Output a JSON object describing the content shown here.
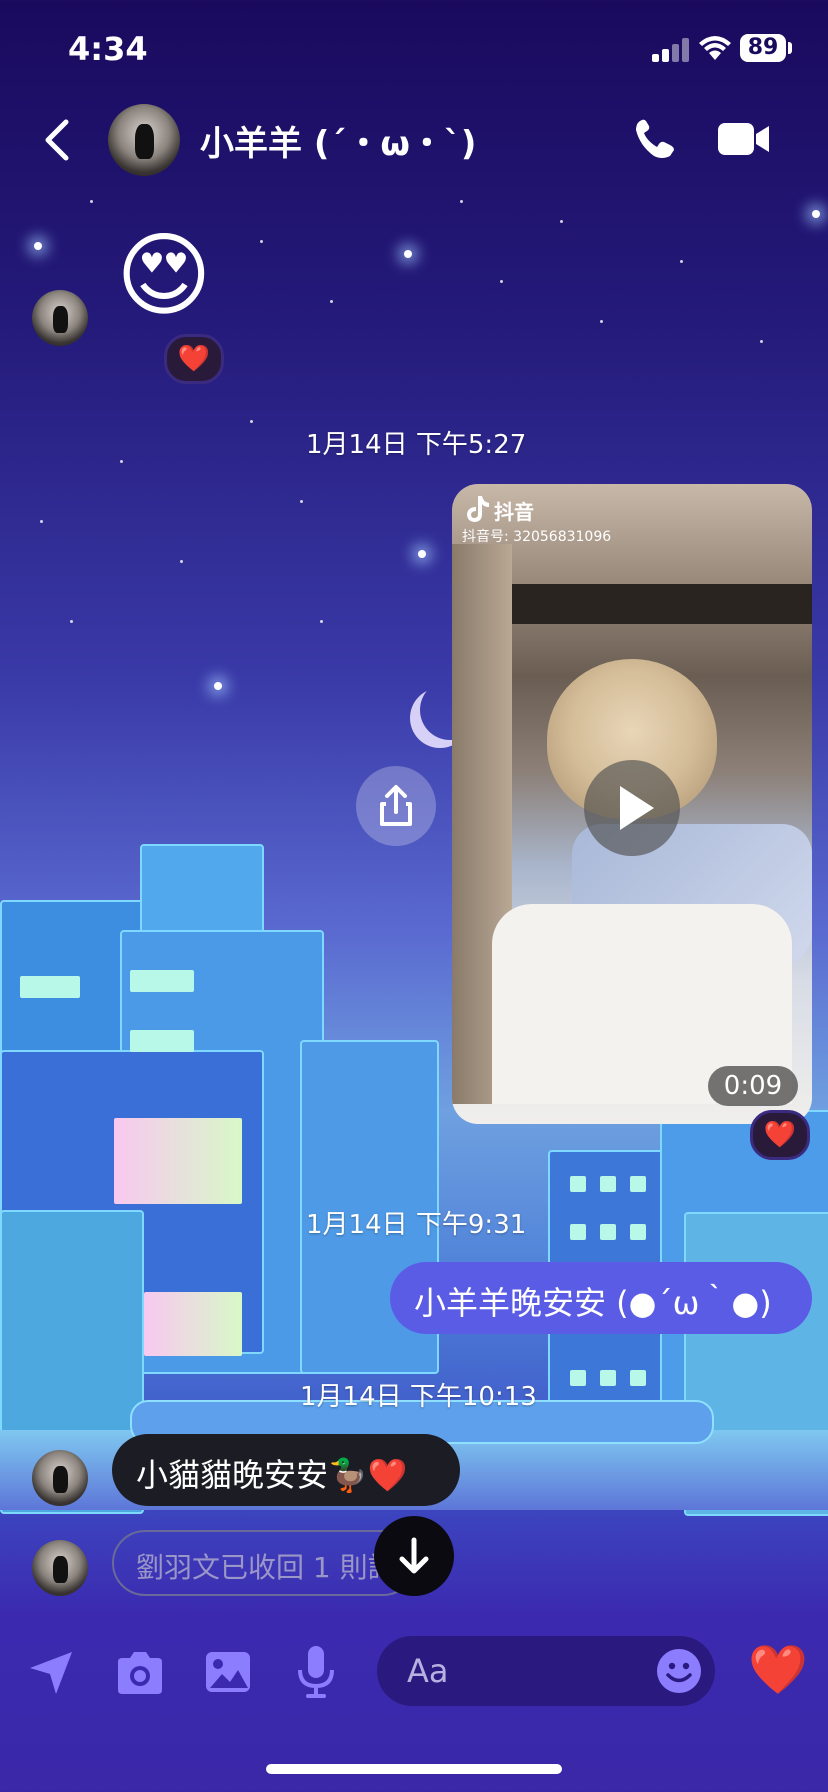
{
  "status": {
    "time": "4:34",
    "battery": "89"
  },
  "header": {
    "contact_name": "小羊羊 (´・ω・`)"
  },
  "messages": {
    "emoji_reply": "😍",
    "emoji_reaction": "❤️",
    "date1": "1月14日 下午5:27",
    "video": {
      "app_name": "抖音",
      "account": "抖音号: 32056831096",
      "duration": "0:09",
      "reaction": "❤️"
    },
    "date2": "1月14日 下午9:31",
    "sent_text": "小羊羊晚安安 (●´ω｀●)",
    "date3": "1月14日 下午10:13",
    "received_text": "小貓貓晚安安🦆❤️",
    "unsent_notice": "劉羽文已收回 1 則訊"
  },
  "composer": {
    "placeholder": "Aa",
    "like_emoji": "❤️"
  },
  "colors": {
    "accent": "#5b5ce6",
    "tool_icons": "#8c7dff",
    "bubble_dark": "#1c1c24"
  }
}
